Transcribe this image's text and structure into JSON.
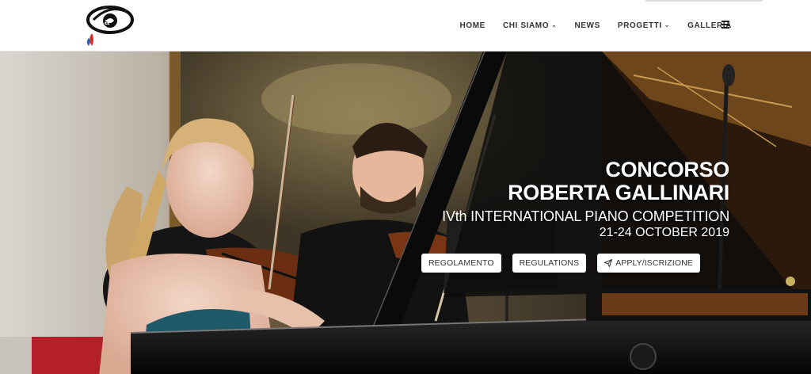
{
  "nav": {
    "items": [
      {
        "label": "HOME",
        "has_dropdown": false
      },
      {
        "label": "CHI SIAMO",
        "has_dropdown": true
      },
      {
        "label": "NEWS",
        "has_dropdown": false
      },
      {
        "label": "PROGETTI",
        "has_dropdown": true
      },
      {
        "label": "GALLERIA",
        "has_dropdown": false
      }
    ],
    "menu_icon": "hamburger-icon",
    "chevron_glyph": "⌄"
  },
  "hero": {
    "title_line1": "CONCORSO",
    "title_line2": "ROBERTA GALLINARI",
    "subtitle": "IVth INTERNATIONAL PIANO COMPETITION",
    "dates": "21-24 OCTOBER 2019",
    "buttons": [
      {
        "label": "REGOLAMENTO",
        "icon": null
      },
      {
        "label": "REGULATIONS",
        "icon": null
      },
      {
        "label": "APPLY/ISCRIZIONE",
        "icon": "paper-plane-icon"
      }
    ]
  },
  "colors": {
    "header_bg": "#ffffff",
    "nav_text": "#333333",
    "hero_text": "#ffffff",
    "button_bg": "#ffffff",
    "logo_red": "#d7312b",
    "logo_blue": "#2a57a8"
  }
}
